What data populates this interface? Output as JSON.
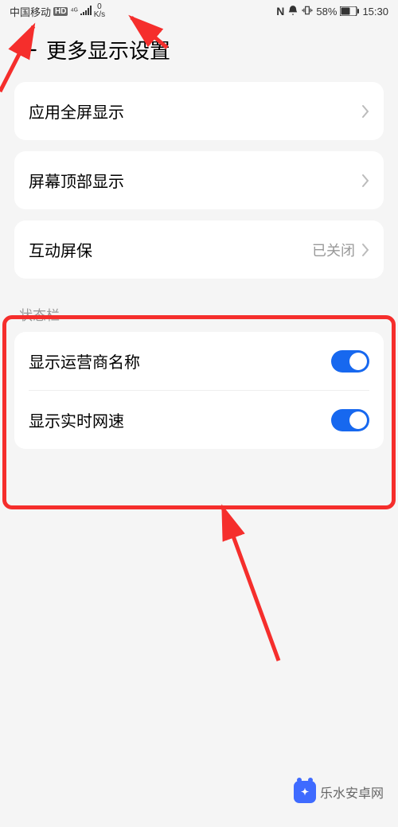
{
  "status_bar": {
    "carrier": "中国移动",
    "hd": "HD",
    "signal_4g": "4G",
    "net_speed_value": "0",
    "net_speed_unit": "K/s",
    "nfc": "N",
    "battery_pct": "58%",
    "time": "15:30"
  },
  "header": {
    "title": "更多显示设置"
  },
  "rows": {
    "fullscreen": "应用全屏显示",
    "topbar": "屏幕顶部显示",
    "screensaver_label": "互动屏保",
    "screensaver_value": "已关闭"
  },
  "section": {
    "heading": "状态栏",
    "carrier_name": "显示运营商名称",
    "realtime_speed": "显示实时网速",
    "carrier_toggle_on": true,
    "speed_toggle_on": true
  },
  "watermark": "乐水安卓网",
  "annotation_color": "#f52e2c"
}
